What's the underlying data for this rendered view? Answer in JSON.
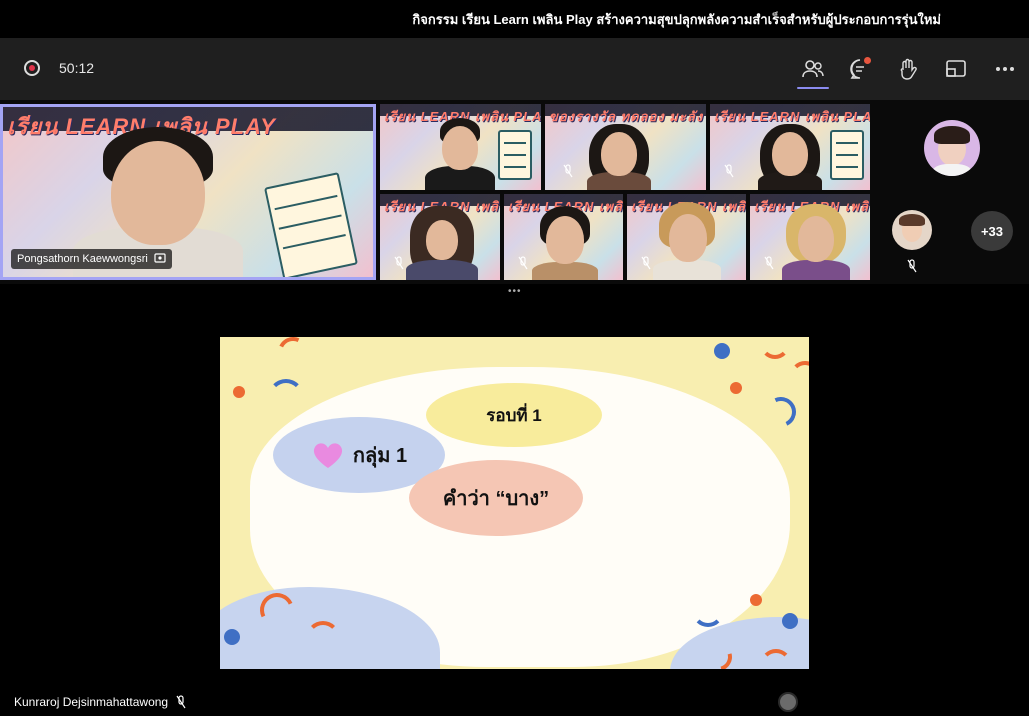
{
  "window": {
    "title": "กิจกรรม เรียน Learn เพลิน Play สร้างความสุขปลุกพลังความสำเร็จสำหรับผู้ประกอบการรุ่นใหม่"
  },
  "toolbar": {
    "timer": "50:12",
    "record_icon": "record-icon",
    "buttons": [
      "people-icon",
      "chat-icon",
      "raise-hand-icon",
      "share-screen-icon",
      "more-options-icon"
    ],
    "accent": "#8b8cf0",
    "notification_color": "#e8563f"
  },
  "gallery": {
    "poster_title": "เรียน LEARN เพลิน PLAY",
    "poster_title_alt": "ของรางวัล ทดลอง มะลัง",
    "main_participant": {
      "name": "Pongsathorn Kaewwongsri"
    },
    "overflow_count": "+33"
  },
  "slide": {
    "round_label": "รอบที่ 1",
    "group_label": "กลุ่ม 1",
    "word_label": "คำว่า “บาง”",
    "colors": {
      "background": "#f8eeb0",
      "blue": "#c5d2ee",
      "peach": "#f5c6b4",
      "yellow": "#f8ec9c",
      "confetti_orange": "#ec6a33",
      "confetti_blue": "#3f6fc4",
      "heart": "#e98ae0"
    }
  },
  "presenter": {
    "name": "Kunraroj Dejsinmahattawong"
  }
}
